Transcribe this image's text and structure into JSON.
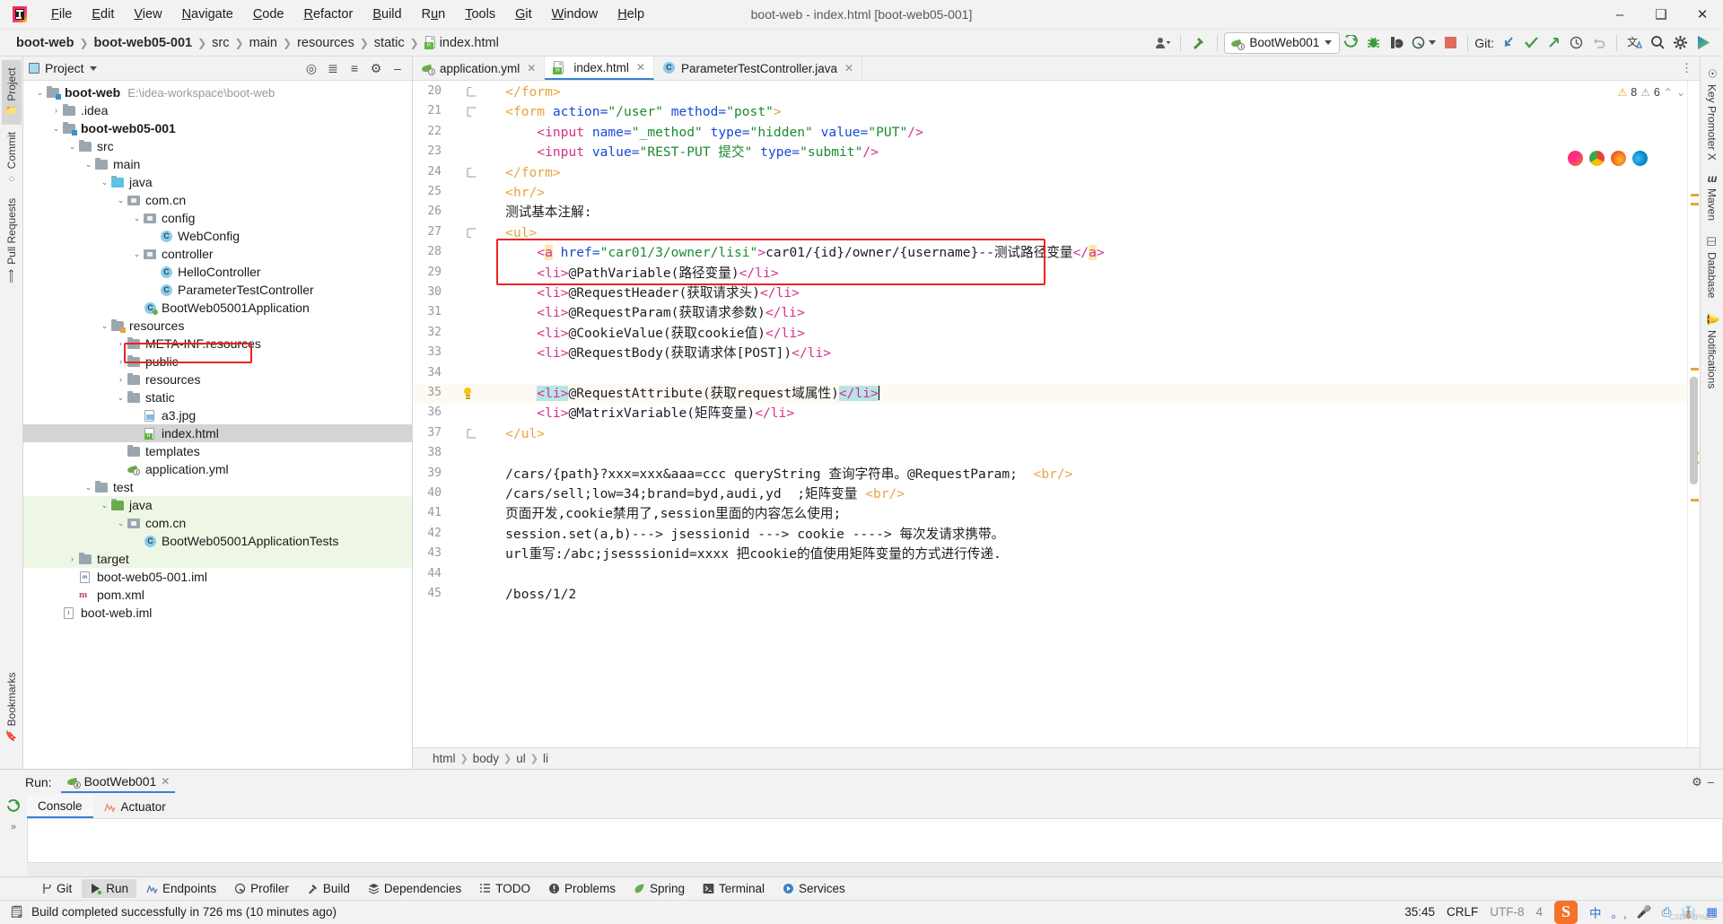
{
  "window": {
    "title": "boot-web - index.html [boot-web05-001]",
    "minimize": "–",
    "maximize": "❑",
    "close": "✕"
  },
  "menu": [
    {
      "label": "File",
      "mnemonic": "F"
    },
    {
      "label": "Edit",
      "mnemonic": "E"
    },
    {
      "label": "View",
      "mnemonic": "V"
    },
    {
      "label": "Navigate",
      "mnemonic": "N"
    },
    {
      "label": "Code",
      "mnemonic": "C"
    },
    {
      "label": "Refactor",
      "mnemonic": "R"
    },
    {
      "label": "Build",
      "mnemonic": "B"
    },
    {
      "label": "Run",
      "mnemonic": "u"
    },
    {
      "label": "Tools",
      "mnemonic": "T"
    },
    {
      "label": "Git",
      "mnemonic": "G"
    },
    {
      "label": "Window",
      "mnemonic": "W"
    },
    {
      "label": "Help",
      "mnemonic": "H"
    }
  ],
  "breadcrumb": [
    "boot-web",
    "boot-web05-001",
    "src",
    "main",
    "resources",
    "static",
    "index.html"
  ],
  "toolbar": {
    "run_config": "BootWeb001",
    "git_label": "Git:",
    "icons": [
      "user-icon",
      "build-hammer-icon",
      "run-icon",
      "debug-icon",
      "run-with-coverage-icon",
      "profiler-icon",
      "stop-icon",
      "git-update-icon",
      "git-commit-icon",
      "git-push-icon",
      "history-icon",
      "rollback-icon",
      "translate-icon",
      "search-icon",
      "settings-icon"
    ]
  },
  "left_rail": [
    {
      "label": "Project",
      "icon": "project-folder-icon",
      "active": true
    },
    {
      "label": "Commit",
      "icon": "commit-icon",
      "active": false
    },
    {
      "label": "Pull Requests",
      "icon": "pull-request-icon",
      "active": false
    }
  ],
  "left_rail_bottom": [
    {
      "label": "Bookmarks",
      "icon": "bookmark-icon"
    }
  ],
  "right_rail": [
    {
      "label": "Key Promoter X",
      "icon": "key-promoter-icon"
    },
    {
      "label": "Maven",
      "icon": "maven-m-icon"
    },
    {
      "label": "Database",
      "icon": "database-icon"
    },
    {
      "label": "Notifications",
      "icon": "bell-icon"
    }
  ],
  "project_panel": {
    "title": "Project",
    "header_icons": [
      "target-icon",
      "collapse-all-icon",
      "expand-icon",
      "settings-icon",
      "hide-icon"
    ],
    "tree": [
      {
        "depth": 0,
        "label": "boot-web",
        "suffix": "E:\\idea-workspace\\boot-web",
        "icon": "module-folder-icon",
        "arrow": "down",
        "bold": true
      },
      {
        "depth": 1,
        "label": ".idea",
        "icon": "folder-icon",
        "arrow": "right",
        "bold": false
      },
      {
        "depth": 1,
        "label": "boot-web05-001",
        "icon": "module-folder-icon",
        "arrow": "down",
        "bold": true
      },
      {
        "depth": 2,
        "label": "src",
        "icon": "folder-icon",
        "arrow": "down",
        "bold": false
      },
      {
        "depth": 3,
        "label": "main",
        "icon": "folder-icon",
        "arrow": "down",
        "bold": false
      },
      {
        "depth": 4,
        "label": "java",
        "icon": "source-folder-icon",
        "arrow": "down",
        "bold": false
      },
      {
        "depth": 5,
        "label": "com.cn",
        "icon": "package-icon",
        "arrow": "down",
        "bold": false
      },
      {
        "depth": 6,
        "label": "config",
        "icon": "package-icon",
        "arrow": "down",
        "bold": false
      },
      {
        "depth": 7,
        "label": "WebConfig",
        "icon": "java-class-icon",
        "arrow": "none",
        "bold": false
      },
      {
        "depth": 6,
        "label": "controller",
        "icon": "package-icon",
        "arrow": "down",
        "bold": false
      },
      {
        "depth": 7,
        "label": "HelloController",
        "icon": "java-class-icon",
        "arrow": "none",
        "bold": false
      },
      {
        "depth": 7,
        "label": "ParameterTestController",
        "icon": "java-class-icon",
        "arrow": "none",
        "bold": false
      },
      {
        "depth": 6,
        "label": "BootWeb05001Application",
        "icon": "spring-boot-class-icon",
        "arrow": "none",
        "bold": false
      },
      {
        "depth": 4,
        "label": "resources",
        "icon": "resource-folder-icon",
        "arrow": "down",
        "bold": false
      },
      {
        "depth": 5,
        "label": "META-INF.resources",
        "icon": "folder-icon",
        "arrow": "right",
        "bold": false
      },
      {
        "depth": 5,
        "label": "public",
        "icon": "folder-icon",
        "arrow": "right",
        "bold": false
      },
      {
        "depth": 5,
        "label": "resources",
        "icon": "folder-icon",
        "arrow": "right",
        "bold": false
      },
      {
        "depth": 5,
        "label": "static",
        "icon": "folder-icon",
        "arrow": "down",
        "bold": false
      },
      {
        "depth": 6,
        "label": "a3.jpg",
        "icon": "image-file-icon",
        "arrow": "none",
        "bold": false
      },
      {
        "depth": 6,
        "label": "index.html",
        "icon": "html-file-icon",
        "arrow": "none",
        "bold": false,
        "selected": true,
        "highlighted": true
      },
      {
        "depth": 5,
        "label": "templates",
        "icon": "folder-icon",
        "arrow": "none",
        "bold": false
      },
      {
        "depth": 5,
        "label": "application.yml",
        "icon": "spring-yaml-icon",
        "arrow": "none",
        "bold": false
      },
      {
        "depth": 3,
        "label": "test",
        "icon": "folder-icon",
        "arrow": "down",
        "bold": false
      },
      {
        "depth": 4,
        "label": "java",
        "icon": "test-source-folder-icon",
        "arrow": "down",
        "bold": false,
        "green": true
      },
      {
        "depth": 5,
        "label": "com.cn",
        "icon": "package-icon",
        "arrow": "down",
        "bold": false,
        "green": true
      },
      {
        "depth": 6,
        "label": "BootWeb05001ApplicationTests",
        "icon": "java-class-icon",
        "arrow": "none",
        "bold": false,
        "green": true
      },
      {
        "depth": 2,
        "label": "target",
        "icon": "folder-icon",
        "arrow": "right",
        "bold": false,
        "green": true
      },
      {
        "depth": 2,
        "label": "boot-web05-001.iml",
        "icon": "maven-iml-icon",
        "arrow": "none",
        "bold": false
      },
      {
        "depth": 2,
        "label": "pom.xml",
        "icon": "maven-icon",
        "arrow": "none",
        "bold": false
      },
      {
        "depth": 1,
        "label": "boot-web.iml",
        "icon": "iml-file-icon",
        "arrow": "none",
        "bold": false
      }
    ]
  },
  "editor": {
    "tabs": [
      {
        "label": "application.yml",
        "icon": "spring-yaml-icon",
        "active": false,
        "closable": true
      },
      {
        "label": "index.html",
        "icon": "html-file-icon",
        "active": true,
        "closable": true
      },
      {
        "label": "ParameterTestController.java",
        "icon": "java-class-icon",
        "active": false,
        "closable": true
      }
    ],
    "inspection": {
      "warning_count": "8",
      "weak_count": "6",
      "warning_icon": "warning-triangle-icon",
      "weak_icon": "weak-warning-icon"
    },
    "float_icons": [
      "jetbrains-browser-icon",
      "chrome-icon",
      "firefox-icon",
      "edge-icon"
    ],
    "first_line_number": 20,
    "lines": [
      {
        "n": 20,
        "fold": "end",
        "tokens": [
          {
            "t": "    ",
            "c": "t-txt"
          },
          {
            "t": "</form>",
            "c": "t-tagn"
          }
        ]
      },
      {
        "n": 21,
        "fold": "start",
        "tokens": [
          {
            "t": "    ",
            "c": "t-txt"
          },
          {
            "t": "<form ",
            "c": "t-tagn"
          },
          {
            "t": "action=",
            "c": "t-attr"
          },
          {
            "t": "\"/user\"",
            "c": "t-str"
          },
          {
            "t": " method=",
            "c": "t-attr"
          },
          {
            "t": "\"post\"",
            "c": "t-str"
          },
          {
            "t": ">",
            "c": "t-tagn"
          }
        ]
      },
      {
        "n": 22,
        "fold": "",
        "tokens": [
          {
            "t": "        ",
            "c": "t-txt"
          },
          {
            "t": "<input ",
            "c": "t-li"
          },
          {
            "t": "name=",
            "c": "t-attr"
          },
          {
            "t": "\"_method\"",
            "c": "t-str"
          },
          {
            "t": " type=",
            "c": "t-attr"
          },
          {
            "t": "\"hidden\"",
            "c": "t-str"
          },
          {
            "t": " value=",
            "c": "t-attr"
          },
          {
            "t": "\"PUT\"",
            "c": "t-str"
          },
          {
            "t": "/>",
            "c": "t-li"
          }
        ]
      },
      {
        "n": 23,
        "fold": "",
        "tokens": [
          {
            "t": "        ",
            "c": "t-txt"
          },
          {
            "t": "<input ",
            "c": "t-li"
          },
          {
            "t": "value=",
            "c": "t-attr"
          },
          {
            "t": "\"REST-PUT 提交\"",
            "c": "t-str"
          },
          {
            "t": " type=",
            "c": "t-attr"
          },
          {
            "t": "\"submit\"",
            "c": "t-str"
          },
          {
            "t": "/>",
            "c": "t-li"
          }
        ]
      },
      {
        "n": 24,
        "fold": "end",
        "tokens": [
          {
            "t": "    ",
            "c": "t-txt"
          },
          {
            "t": "</form>",
            "c": "t-tagn"
          }
        ]
      },
      {
        "n": 25,
        "fold": "",
        "tokens": [
          {
            "t": "    ",
            "c": "t-txt"
          },
          {
            "t": "<hr/>",
            "c": "t-tagn"
          }
        ]
      },
      {
        "n": 26,
        "fold": "",
        "tokens": [
          {
            "t": "    测试基本注解:",
            "c": "t-txt"
          }
        ]
      },
      {
        "n": 27,
        "fold": "start",
        "tokens": [
          {
            "t": "    ",
            "c": "t-txt"
          },
          {
            "t": "<ul>",
            "c": "t-tagn"
          }
        ]
      },
      {
        "n": 28,
        "fold": "",
        "tokens": [
          {
            "t": "        ",
            "c": "t-txt"
          },
          {
            "t": "<",
            "c": "t-a"
          },
          {
            "t": "a",
            "c": "t-a hl-ident"
          },
          {
            "t": " href=",
            "c": "t-attr"
          },
          {
            "t": "\"car01/3/owner/lisi\"",
            "c": "t-str"
          },
          {
            "t": ">",
            "c": "t-a"
          },
          {
            "t": "car01/{id}/owner/{username}--测试路径变量",
            "c": "t-txt"
          },
          {
            "t": "</",
            "c": "t-a"
          },
          {
            "t": "a",
            "c": "t-a hl-ident"
          },
          {
            "t": ">",
            "c": "t-a"
          }
        ]
      },
      {
        "n": 29,
        "fold": "",
        "tokens": [
          {
            "t": "        ",
            "c": "t-txt"
          },
          {
            "t": "<li>",
            "c": "t-li"
          },
          {
            "t": "@PathVariable(路径变量)",
            "c": "t-txt"
          },
          {
            "t": "</li>",
            "c": "t-li"
          }
        ]
      },
      {
        "n": 30,
        "fold": "",
        "tokens": [
          {
            "t": "        ",
            "c": "t-txt"
          },
          {
            "t": "<li>",
            "c": "t-li"
          },
          {
            "t": "@RequestHeader(获取请求头)",
            "c": "t-txt"
          },
          {
            "t": "</li>",
            "c": "t-li"
          }
        ]
      },
      {
        "n": 31,
        "fold": "",
        "tokens": [
          {
            "t": "        ",
            "c": "t-txt"
          },
          {
            "t": "<li>",
            "c": "t-li"
          },
          {
            "t": "@RequestParam(获取请求参数)",
            "c": "t-txt"
          },
          {
            "t": "</li>",
            "c": "t-li"
          }
        ]
      },
      {
        "n": 32,
        "fold": "",
        "tokens": [
          {
            "t": "        ",
            "c": "t-txt"
          },
          {
            "t": "<li>",
            "c": "t-li"
          },
          {
            "t": "@CookieValue(获取cookie值)",
            "c": "t-txt"
          },
          {
            "t": "</li>",
            "c": "t-li"
          }
        ]
      },
      {
        "n": 33,
        "fold": "",
        "tokens": [
          {
            "t": "        ",
            "c": "t-txt"
          },
          {
            "t": "<li>",
            "c": "t-li"
          },
          {
            "t": "@RequestBody(获取请求体[POST])",
            "c": "t-txt"
          },
          {
            "t": "</li>",
            "c": "t-li"
          }
        ]
      },
      {
        "n": 34,
        "fold": "",
        "tokens": []
      },
      {
        "n": 35,
        "fold": "",
        "bulb": true,
        "current": true,
        "tokens": [
          {
            "t": "        ",
            "c": "t-txt"
          },
          {
            "t": "<li>",
            "c": "t-li sel-hl"
          },
          {
            "t": "@RequestAttribute(获取request域属性)",
            "c": "t-txt"
          },
          {
            "t": "</li>",
            "c": "t-li sel-hl"
          }
        ],
        "caret": true
      },
      {
        "n": 36,
        "fold": "",
        "tokens": [
          {
            "t": "        ",
            "c": "t-txt"
          },
          {
            "t": "<li>",
            "c": "t-li"
          },
          {
            "t": "@MatrixVariable(矩阵变量)",
            "c": "t-txt"
          },
          {
            "t": "</li>",
            "c": "t-li"
          }
        ]
      },
      {
        "n": 37,
        "fold": "end",
        "tokens": [
          {
            "t": "    ",
            "c": "t-txt"
          },
          {
            "t": "</ul>",
            "c": "t-tagn"
          }
        ]
      },
      {
        "n": 38,
        "fold": "",
        "tokens": []
      },
      {
        "n": 39,
        "fold": "",
        "tokens": [
          {
            "t": "    /cars/{path}?xxx=xxx&aaa=ccc queryString 查询字符串。@RequestParam;  ",
            "c": "t-txt"
          },
          {
            "t": "<br/>",
            "c": "t-br"
          }
        ]
      },
      {
        "n": 40,
        "fold": "",
        "tokens": [
          {
            "t": "    /cars/sell;low=34;brand=byd,audi,yd  ;矩阵变量 ",
            "c": "t-txt"
          },
          {
            "t": "<br/>",
            "c": "t-br"
          }
        ]
      },
      {
        "n": 41,
        "fold": "",
        "tokens": [
          {
            "t": "    页面开发,cookie禁用了,session里面的内容怎么使用;",
            "c": "t-txt"
          }
        ]
      },
      {
        "n": 42,
        "fold": "",
        "tokens": [
          {
            "t": "    session.set(a,b)---> jsessionid ---> cookie ----> 每次发请求携带。",
            "c": "t-txt"
          }
        ]
      },
      {
        "n": 43,
        "fold": "",
        "tokens": [
          {
            "t": "    url重写:/abc;jsesssionid=xxxx 把cookie的值使用矩阵变量的方式进行传递.",
            "c": "t-txt"
          }
        ]
      },
      {
        "n": 44,
        "fold": "",
        "tokens": []
      },
      {
        "n": 45,
        "fold": "",
        "tokens": [
          {
            "t": "    /boss/1/2",
            "c": "t-txt"
          }
        ]
      }
    ],
    "breadcrumbs": [
      "html",
      "body",
      "ul",
      "li"
    ]
  },
  "run_panel": {
    "label": "Run:",
    "config_tab": "BootWeb001",
    "tabs": [
      {
        "label": "Console",
        "icon": "console-icon",
        "active": true
      },
      {
        "label": "Actuator",
        "icon": "actuator-icon",
        "active": false
      }
    ],
    "rerun_icon": "rerun-icon",
    "expand_chevrons": "»"
  },
  "tool_windows": [
    {
      "label": "Git",
      "icon": "git-branch-icon",
      "active": false
    },
    {
      "label": "Run",
      "icon": "run-green-icon",
      "active": true
    },
    {
      "label": "Endpoints",
      "icon": "endpoints-icon",
      "active": false
    },
    {
      "label": "Profiler",
      "icon": "profiler-icon",
      "active": false
    },
    {
      "label": "Build",
      "icon": "build-hammer-icon",
      "active": false
    },
    {
      "label": "Dependencies",
      "icon": "dependencies-icon",
      "active": false
    },
    {
      "label": "TODO",
      "icon": "todo-list-icon",
      "active": false
    },
    {
      "label": "Problems",
      "icon": "problems-icon",
      "active": false
    },
    {
      "label": "Spring",
      "icon": "spring-leaf-icon",
      "active": false
    },
    {
      "label": "Terminal",
      "icon": "terminal-icon",
      "active": false
    },
    {
      "label": "Services",
      "icon": "services-icon",
      "active": false
    }
  ],
  "status_bar": {
    "message": "Build completed successfully in 726 ms (10 minutes ago)",
    "message_icon": "event-log-icon",
    "caret_position": "35:45",
    "line_separator": "CRLF",
    "encoding": "UTF-8",
    "indent": "4",
    "ime": {
      "app_icon": "sogou-s-icon",
      "mode": "中",
      "punctuation": "。,",
      "voice_icon": "microphone-icon",
      "keyboard_icon": "soft-keyboard-icon",
      "toolbox_icon": "toolbox-icon",
      "menu_icon": "ime-menu-icon"
    },
    "watermark": "CSDN @%E5"
  }
}
